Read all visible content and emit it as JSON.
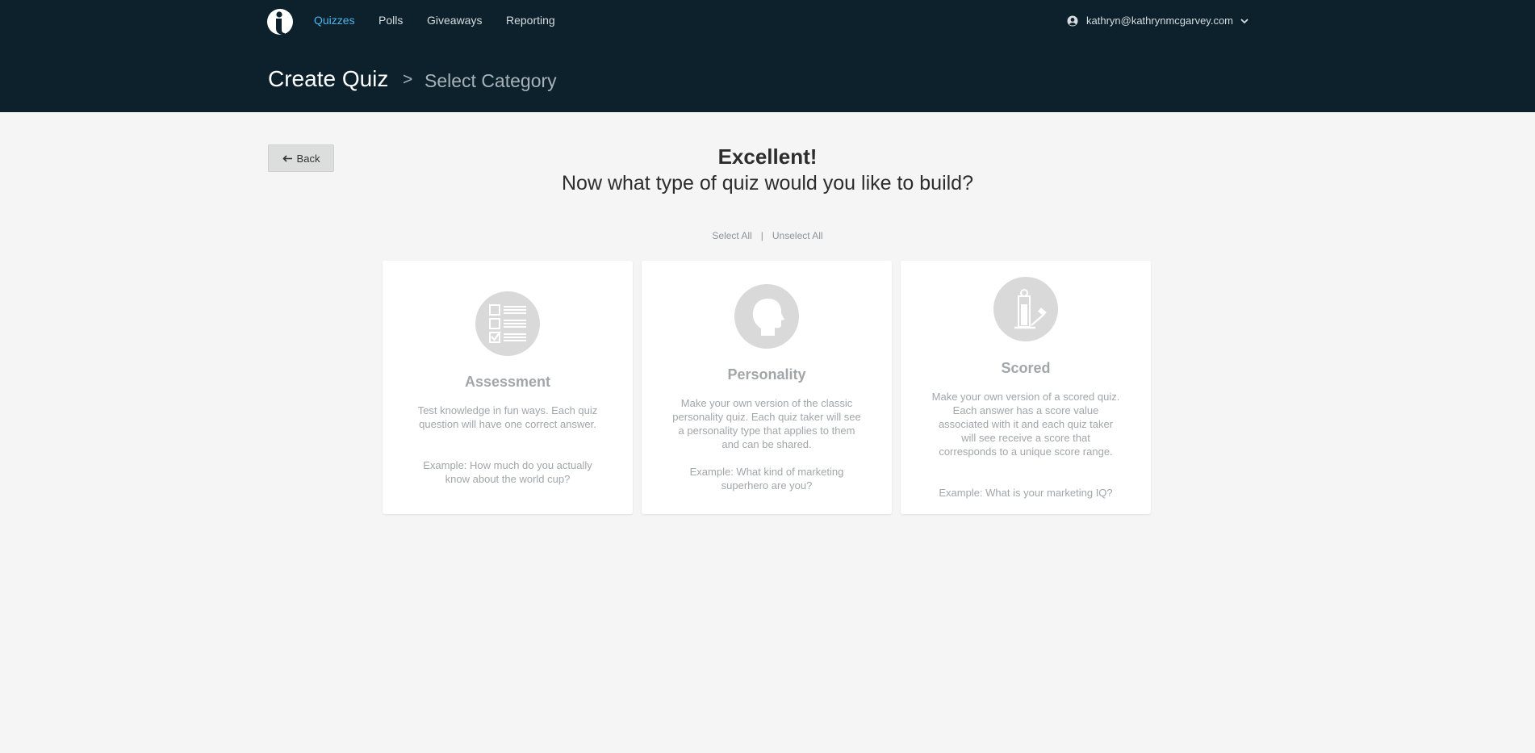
{
  "header": {
    "logo_icon": "info-logo-icon",
    "nav": [
      {
        "label": "Quizzes",
        "active": true
      },
      {
        "label": "Polls",
        "active": false
      },
      {
        "label": "Giveaways",
        "active": false
      },
      {
        "label": "Reporting",
        "active": false
      }
    ],
    "account": {
      "icon": "user-icon",
      "email": "kathryn@kathrynmcgarvey.com",
      "dropdown_icon": "chevron-down-icon"
    },
    "title": "Create Quiz",
    "breadcrumb_separator": ">",
    "breadcrumb_current": "Select Category"
  },
  "main": {
    "back_button": {
      "icon": "arrow-left-icon",
      "label": "Back"
    },
    "headline": "Excellent!",
    "subheadline": "Now what type of quiz would you like to build?",
    "select_all": "Select All",
    "divider": "|",
    "unselect_all": "Unselect All",
    "cards": [
      {
        "icon": "checklist-icon",
        "title": "Assessment",
        "description": "Test knowledge in fun ways. Each quiz question will have one correct answer.",
        "example": "Example: How much do you actually know about the world cup?"
      },
      {
        "icon": "head-profile-icon",
        "title": "Personality",
        "description": "Make your own version of the classic personality quiz. Each quiz taker will see a personality type that applies to them and can be shared.",
        "example": "Example: What kind of marketing superhero are you?"
      },
      {
        "icon": "strength-tester-icon",
        "title": "Scored",
        "description": "Make your own version of a scored quiz. Each answer has a score value associated with it and each quiz taker will see receive a score that corresponds to a unique score range.",
        "example": "Example: What is your marketing IQ?"
      }
    ]
  },
  "colors": {
    "header_bg": "#0c212c",
    "page_bg": "#f4f5f4",
    "nav_active": "#4fb3ea",
    "nav_text": "#d7dde0",
    "card_text": "#a2a6a8",
    "icon_circle": "#d9d9d9"
  }
}
